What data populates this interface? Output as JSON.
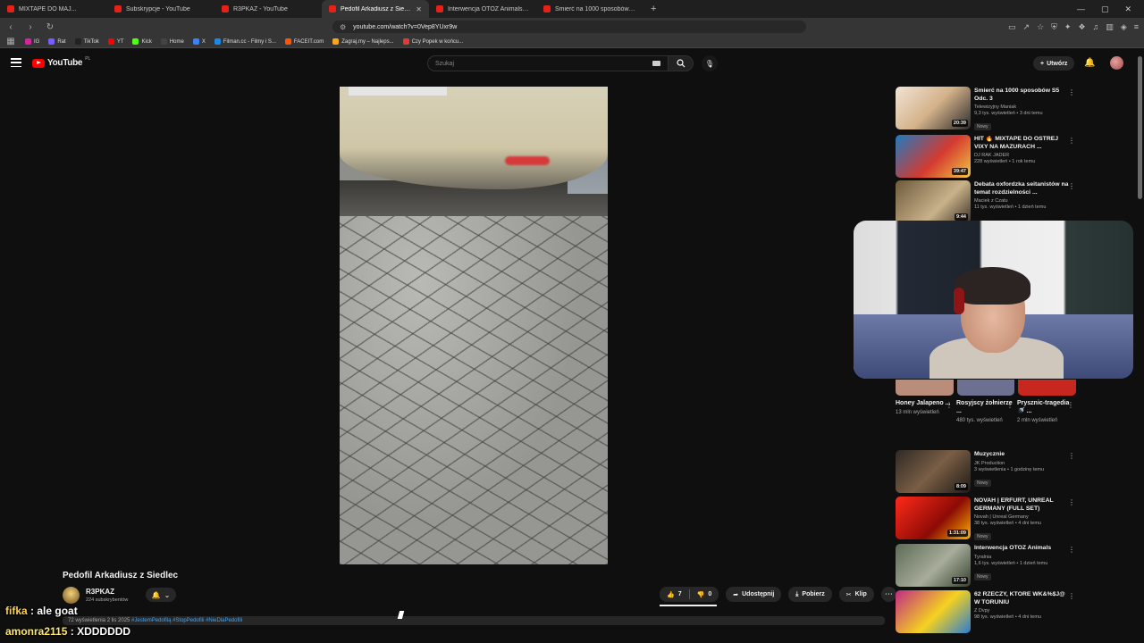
{
  "browser": {
    "tabs": [
      {
        "title": "MIXTAPE DO MAJ...",
        "active": false
      },
      {
        "title": "Subskrypcje - YouTube",
        "active": false
      },
      {
        "title": "R3PKAZ - YouTube",
        "active": false
      },
      {
        "title": "Pedofil Arkadiusz z Siedlec -",
        "active": true
      },
      {
        "title": "Interwencja OTOZ Animals - YouTube",
        "active": false
      },
      {
        "title": "Śmierć na 1000 sposobów S5 Odc. 3",
        "active": false
      }
    ],
    "url": "youtube.com/watch?v=0Vep8YUxr9w",
    "bookmarks": [
      {
        "label": "IG",
        "color": "#d6249f"
      },
      {
        "label": "Rat",
        "color": "#7b5cff"
      },
      {
        "label": "TikTok",
        "color": "#222222"
      },
      {
        "label": "YT",
        "color": "#ff0000"
      },
      {
        "label": "Kick",
        "color": "#53fc18"
      },
      {
        "label": "Home",
        "color": "#444444"
      },
      {
        "label": "X",
        "color": "#3b82f6"
      },
      {
        "label": "Filman.cc - Filmy i S...",
        "color": "#1e88e5"
      },
      {
        "label": "FACEIT.com",
        "color": "#ff5500"
      },
      {
        "label": "Zagraj.my – Najleps...",
        "color": "#f5a623"
      },
      {
        "label": "Czy Popek w końcu...",
        "color": "#e53935"
      }
    ]
  },
  "yt": {
    "logo_text": "YouTube",
    "logo_cc": "PL",
    "search_placeholder": "Szukaj",
    "create_label": "Utwórz"
  },
  "video": {
    "title": "Pedofil Arkadiusz z Siedlec",
    "channel": "R3PKAZ",
    "subscribers": "224 subskrybentów",
    "likes": "7",
    "dislikes": "0",
    "share_label": "Udostępnij",
    "download_label": "Pobierz",
    "clip_label": "Klip",
    "desc_meta": "72 wyświetlenia  2 lis 2025",
    "desc_tags": "#JestemPedofilą #StopPedofili #NieDlaPedofili"
  },
  "recommendations": [
    {
      "title": "Śmierć na 1000 sposobów S5 Odc. 3",
      "channel": "Telewizyjny Maniak",
      "meta": "9,3 tys. wyświetleń • 3 dni temu",
      "badge": "Nowy",
      "duration": "20:39",
      "thumb": "linear-gradient(135deg,#f1e4d6,#d4b28a 50%,#2b2b2b)"
    },
    {
      "title": "HIT 🔥 MIXTAPE DO OSTREJ VIXY NA MAZURACH ...",
      "channel": "DJ RAK JADER",
      "meta": "228 wyświetleń • 1 rok temu",
      "badge": "",
      "duration": "39:47",
      "thumb": "linear-gradient(135deg,#1f7ac0,#d43a2f 55%,#f2c744)"
    },
    {
      "title": "Debata oxfordzka seitanistów na temat rozdzielności ...",
      "channel": "Maciek z Czatu",
      "meta": "11 tys. wyświetleń • 1 dzień temu",
      "badge": "",
      "duration": "9:44",
      "thumb": "linear-gradient(135deg,#6d5a3c,#c9b28a 60%,#3b3226)"
    },
    {
      "title": "Muzycznie",
      "channel": "JK Production",
      "meta": "3 wyświetlenia • 1 godzinę temu",
      "badge": "Nowy",
      "duration": "8:09",
      "thumb": "linear-gradient(135deg,#2f2a24,#7a5e45 50%,#1e1a16)"
    },
    {
      "title": "NOVAH | ERFURT, UNREAL GERMANY (FULL SET)",
      "channel": "Novah | Unreal Germany",
      "meta": "38 tys. wyświetleń • 4 dni temu",
      "badge": "Nowy",
      "duration": "1:31:09",
      "thumb": "linear-gradient(135deg,#ff2a1a,#8c0b05 60%,#ffb100)"
    },
    {
      "title": "Interwencja OTOZ Animals",
      "channel": "Tyralnia",
      "meta": "1,6 tys. wyświetleń • 1 dzień temu",
      "badge": "Nowy",
      "duration": "17:10",
      "thumb": "linear-gradient(135deg,#5d6b55,#a7ad9a 55%,#36402f)"
    },
    {
      "title": "62 RZECZY, KTÓRE WK&%$J@ W TORUNIU",
      "channel": "Z Dvpy",
      "meta": "98 tys. wyświetleń • 4 dni temu",
      "badge": "",
      "duration": "",
      "thumb": "linear-gradient(135deg,#c02a86,#f4d21f 55%,#2a7bd4)"
    }
  ],
  "shorts": [
    {
      "title": "Honey Jalapeno ...",
      "views": "13 mln wyświetleń",
      "thumb": "#b98d7a"
    },
    {
      "title": "Rosyjscy żołnierze ...",
      "views": "480 tys. wyświetleń",
      "thumb": "#6d7090"
    },
    {
      "title": "Prysznic-tragedia 🚿 ...",
      "views": "2 mln wyświetleń",
      "thumb": "#c7271f"
    }
  ],
  "chat": [
    {
      "user": "fifka",
      "message": "ale goat"
    },
    {
      "user": "amonra2115",
      "message": "XDDDDDD"
    }
  ]
}
